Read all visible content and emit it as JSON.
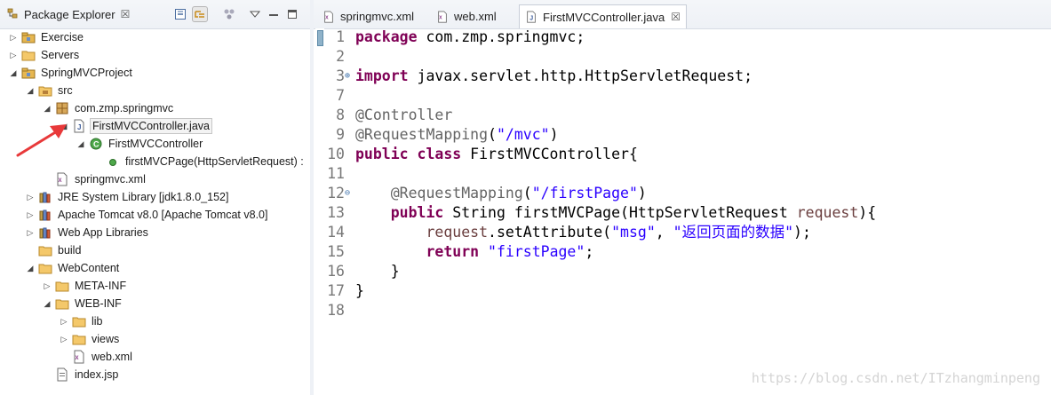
{
  "explorer": {
    "title": "Package Explorer",
    "close": "☒",
    "toolbar": [
      "collapse-all-icon",
      "link-with-editor-icon",
      "focus-icon",
      "view-menu-icon",
      "minimize-icon"
    ],
    "tree": [
      {
        "label": "Exercise",
        "twisty": "▷",
        "icon": "project-icon"
      },
      {
        "label": "Servers",
        "twisty": "▷",
        "icon": "folder-icon"
      },
      {
        "label": "SpringMVCProject",
        "twisty": "◢",
        "icon": "project-icon"
      },
      {
        "label": "src",
        "twisty": "◢",
        "icon": "source-folder-icon"
      },
      {
        "label": "com.zmp.springmvc",
        "twisty": "◢",
        "icon": "package-icon"
      },
      {
        "label": "FirstMVCController.java",
        "twisty": "◢",
        "icon": "java-file-icon",
        "selected": true
      },
      {
        "label": "FirstMVCController",
        "twisty": "◢",
        "icon": "class-icon"
      },
      {
        "label": "firstMVCPage(HttpServletRequest) :",
        "twisty": "",
        "icon": "method-icon"
      },
      {
        "label": "springmvc.xml",
        "twisty": "",
        "icon": "xml-file-icon"
      },
      {
        "label": "JRE System Library [jdk1.8.0_152]",
        "twisty": "▷",
        "icon": "library-icon"
      },
      {
        "label": "Apache Tomcat v8.0 [Apache Tomcat v8.0]",
        "twisty": "▷",
        "icon": "library-icon"
      },
      {
        "label": "Web App Libraries",
        "twisty": "▷",
        "icon": "library-icon"
      },
      {
        "label": "build",
        "twisty": "",
        "icon": "folder-icon"
      },
      {
        "label": "WebContent",
        "twisty": "◢",
        "icon": "folder-icon"
      },
      {
        "label": "META-INF",
        "twisty": "▷",
        "icon": "folder-icon"
      },
      {
        "label": "WEB-INF",
        "twisty": "◢",
        "icon": "folder-icon"
      },
      {
        "label": "lib",
        "twisty": "▷",
        "icon": "folder-icon"
      },
      {
        "label": "views",
        "twisty": "▷",
        "icon": "folder-icon"
      },
      {
        "label": "web.xml",
        "twisty": "",
        "icon": "xml-file-icon"
      },
      {
        "label": "index.jsp",
        "twisty": "",
        "icon": "jsp-file-icon"
      }
    ]
  },
  "editor": {
    "tabs": [
      {
        "label": "springmvc.xml",
        "icon": "xml-file-icon",
        "active": false
      },
      {
        "label": "web.xml",
        "icon": "xml-file-icon",
        "active": false
      },
      {
        "label": "FirstMVCController.java",
        "icon": "java-file-icon",
        "active": true,
        "close": "☒"
      }
    ],
    "lines": [
      {
        "n": "1",
        "fold": "",
        "tokens": [
          [
            "kw",
            "package"
          ],
          [
            "p",
            " com.zmp.springmvc;"
          ]
        ]
      },
      {
        "n": "2",
        "fold": "",
        "tokens": []
      },
      {
        "n": "3",
        "fold": "⊕",
        "tokens": [
          [
            "kw",
            "import"
          ],
          [
            "p",
            " javax.servlet.http.HttpServletRequest;"
          ]
        ]
      },
      {
        "n": "7",
        "fold": "",
        "tokens": []
      },
      {
        "n": "8",
        "fold": "",
        "tokens": [
          [
            "an",
            "@Controller"
          ]
        ]
      },
      {
        "n": "9",
        "fold": "",
        "tokens": [
          [
            "an",
            "@RequestMapping"
          ],
          [
            "p",
            "("
          ],
          [
            "st",
            "\"/mvc\""
          ],
          [
            "p",
            ")"
          ]
        ]
      },
      {
        "n": "10",
        "fold": "",
        "tokens": [
          [
            "kw",
            "public"
          ],
          [
            "p",
            " "
          ],
          [
            "kw",
            "class"
          ],
          [
            "p",
            " FirstMVCController{"
          ]
        ]
      },
      {
        "n": "11",
        "fold": "",
        "tokens": []
      },
      {
        "n": "12",
        "fold": "⊖",
        "tokens": [
          [
            "p",
            "    "
          ],
          [
            "an",
            "@RequestMapping"
          ],
          [
            "p",
            "("
          ],
          [
            "st",
            "\"/firstPage\""
          ],
          [
            "p",
            ")"
          ]
        ]
      },
      {
        "n": "13",
        "fold": "",
        "tokens": [
          [
            "p",
            "    "
          ],
          [
            "kw",
            "public"
          ],
          [
            "p",
            " String firstMVCPage(HttpServletRequest "
          ],
          [
            "pa",
            "request"
          ],
          [
            "p",
            "){"
          ]
        ]
      },
      {
        "n": "14",
        "fold": "",
        "tokens": [
          [
            "p",
            "        "
          ],
          [
            "pa",
            "request"
          ],
          [
            "p",
            ".setAttribute("
          ],
          [
            "st",
            "\"msg\""
          ],
          [
            "p",
            ", "
          ],
          [
            "st",
            "\"返回页面的数据\""
          ],
          [
            "p",
            ");"
          ]
        ]
      },
      {
        "n": "15",
        "fold": "",
        "tokens": [
          [
            "p",
            "        "
          ],
          [
            "kw",
            "return"
          ],
          [
            "p",
            " "
          ],
          [
            "st",
            "\"firstPage\""
          ],
          [
            "p",
            ";"
          ]
        ]
      },
      {
        "n": "16",
        "fold": "",
        "tokens": [
          [
            "p",
            "    }"
          ]
        ]
      },
      {
        "n": "17",
        "fold": "",
        "tokens": [
          [
            "p",
            "}"
          ]
        ]
      },
      {
        "n": "18",
        "fold": "",
        "tokens": []
      }
    ]
  },
  "watermark": "https://blog.csdn.net/ITzhangminpeng",
  "annotation": {
    "color": "#e8393a",
    "icon": "red-arrow-icon"
  }
}
